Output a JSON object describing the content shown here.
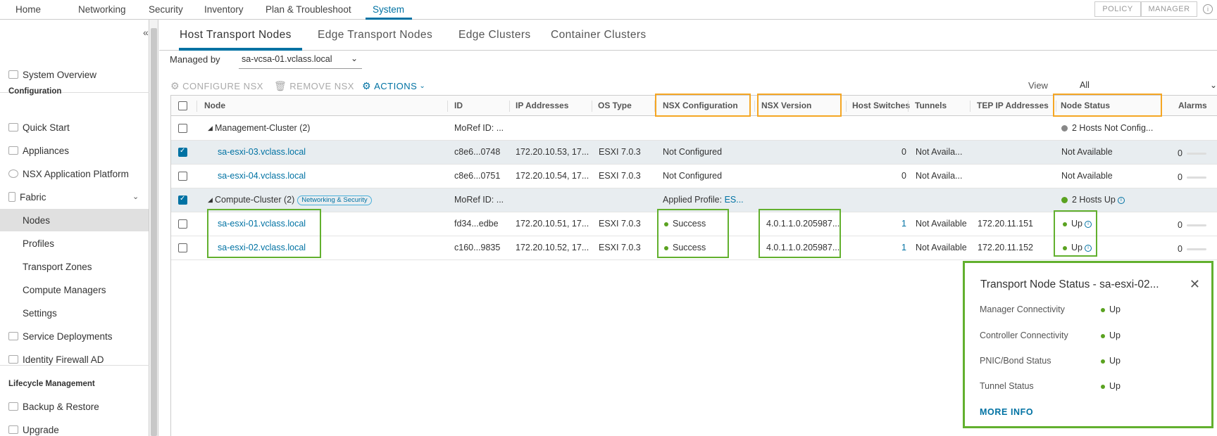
{
  "topnav": {
    "items": [
      "Home",
      "Networking",
      "Security",
      "Inventory",
      "Plan & Troubleshoot",
      "System"
    ],
    "active": "System",
    "mode_policy": "POLICY",
    "mode_manager": "MANAGER"
  },
  "sidebar": {
    "system_overview": "System Overview",
    "configuration_head": "Configuration",
    "quick_start": "Quick Start",
    "appliances": "Appliances",
    "nsx_app_platform": "NSX Application Platform",
    "fabric": "Fabric",
    "nodes": "Nodes",
    "profiles": "Profiles",
    "transport_zones": "Transport Zones",
    "compute_managers": "Compute Managers",
    "settings": "Settings",
    "service_deployments": "Service Deployments",
    "identity_firewall": "Identity Firewall AD",
    "lifecycle_head": "Lifecycle Management",
    "backup_restore": "Backup & Restore",
    "upgrade": "Upgrade"
  },
  "tabs": [
    "Host Transport Nodes",
    "Edge Transport Nodes",
    "Edge Clusters",
    "Container Clusters"
  ],
  "managed_by": {
    "label": "Managed by",
    "value": "sa-vcsa-01.vclass.local"
  },
  "toolbar": {
    "configure": "CONFIGURE NSX",
    "remove": "REMOVE NSX",
    "actions": "ACTIONS",
    "view_label": "View",
    "view_value": "All"
  },
  "columns": [
    "Node",
    "ID",
    "IP Addresses",
    "OS Type",
    "NSX Configuration",
    "NSX Version",
    "Host Switches",
    "Tunnels",
    "TEP IP Addresses",
    "Node Status",
    "Alarms"
  ],
  "rows": [
    {
      "node": "Management-Cluster (2)",
      "id": "MoRef ID: ...",
      "ip": "",
      "os": "",
      "config": "",
      "version": "",
      "switches": "",
      "tunnels": "",
      "tep": "",
      "status": "2 Hosts Not Config...",
      "alarms": ""
    },
    {
      "node": "sa-esxi-03.vclass.local",
      "id": "c8e6...0748",
      "ip": "172.20.10.53, 17...",
      "os": "ESXI 7.0.3",
      "config": "Not Configured",
      "version": "",
      "switches": "0",
      "tunnels": "Not Availa...",
      "tep": "",
      "status": "Not Available",
      "alarms": "0"
    },
    {
      "node": "sa-esxi-04.vclass.local",
      "id": "c8e6...0751",
      "ip": "172.20.10.54, 17...",
      "os": "ESXI 7.0.3",
      "config": "Not Configured",
      "version": "",
      "switches": "0",
      "tunnels": "Not Availa...",
      "tep": "",
      "status": "Not Available",
      "alarms": "0"
    },
    {
      "node": "Compute-Cluster (2)",
      "badge": "Networking & Security",
      "id": "MoRef ID: ...",
      "ip": "",
      "os": "",
      "config_label": "Applied Profile:",
      "config_val": "ES...",
      "version": "",
      "switches": "",
      "tunnels": "",
      "tep": "",
      "status": "2 Hosts Up",
      "alarms": ""
    },
    {
      "node": "sa-esxi-01.vclass.local",
      "id": "fd34...edbe",
      "ip": "172.20.10.51, 17...",
      "os": "ESXI 7.0.3",
      "config": "Success",
      "version": "4.0.1.1.0.205987...",
      "switches": "1",
      "tunnels": "Not Available",
      "tep": "172.20.11.151",
      "status": "Up",
      "alarms": "0"
    },
    {
      "node": "sa-esxi-02.vclass.local",
      "id": "c160...9835",
      "ip": "172.20.10.52, 17...",
      "os": "ESXI 7.0.3",
      "config": "Success",
      "version": "4.0.1.1.0.205987...",
      "switches": "1",
      "tunnels": "Not Available",
      "tep": "172.20.11.152",
      "status": "Up",
      "alarms": "0"
    }
  ],
  "popover": {
    "title": "Transport Node Status - sa-esxi-02...",
    "items": [
      {
        "label": "Manager Connectivity",
        "value": "Up"
      },
      {
        "label": "Controller Connectivity",
        "value": "Up"
      },
      {
        "label": "PNIC/Bond Status",
        "value": "Up"
      },
      {
        "label": "Tunnel Status",
        "value": "Up"
      }
    ],
    "more": "MORE INFO"
  },
  "colors": {
    "accent": "#0072a3",
    "highlight_orange": "#f5a623",
    "highlight_green": "#62b02e",
    "status_green": "#5aa220"
  }
}
